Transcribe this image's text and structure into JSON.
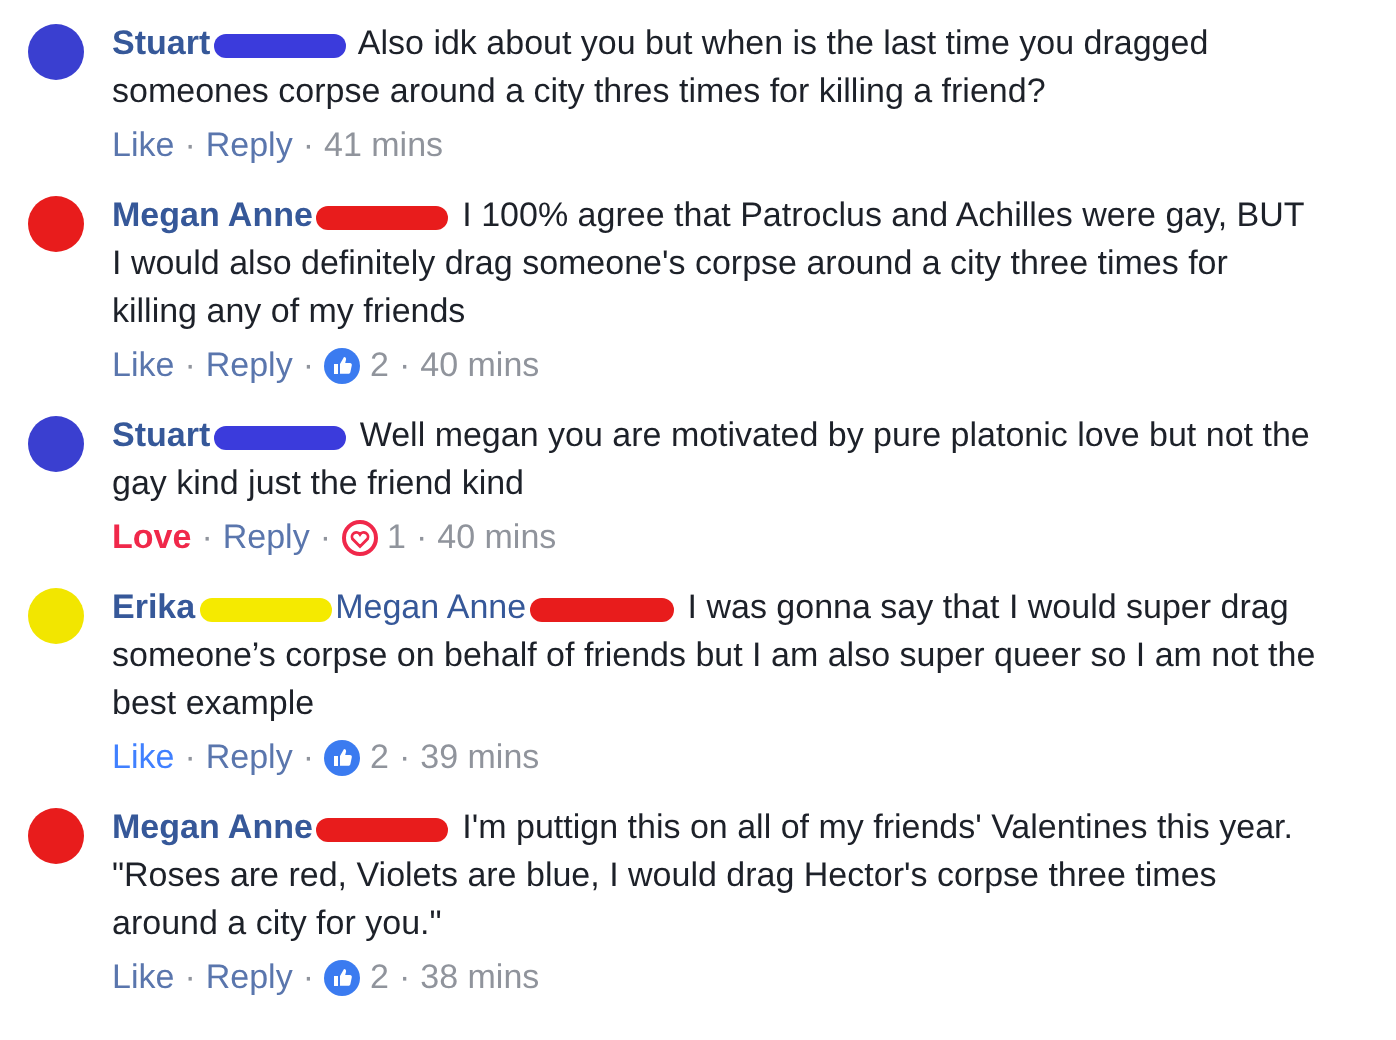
{
  "comments": [
    {
      "avatar": {
        "color": "#3a3fd0"
      },
      "author": "Stuart",
      "author_redaction": {
        "color": "#3b3bdc"
      },
      "text": "Also idk about you but when is the last time you dragged someones corpse around a city thres times for killing a friend?",
      "reaction": {
        "label": "Like",
        "kind": "none"
      },
      "reply": "Reply",
      "separators": [
        "·",
        "·"
      ],
      "time": "41 mins"
    },
    {
      "avatar": {
        "color": "#e81c1c"
      },
      "author": "Megan Anne",
      "author_redaction": {
        "color": "#e81c1c"
      },
      "text": "I 100% agree that Patroclus and Achilles were gay, BUT I would also definitely drag someone's corpse around a city three times for killing any of my friends",
      "reaction": {
        "label": "Like",
        "kind": "none"
      },
      "reply": "Reply",
      "separators": [
        "·",
        "·",
        "·"
      ],
      "count": {
        "kind": "like",
        "value": "2"
      },
      "time": "40 mins"
    },
    {
      "avatar": {
        "color": "#3a3fd0"
      },
      "author": "Stuart",
      "author_redaction": {
        "color": "#3b3bdc"
      },
      "text": "Well megan you are motivated by pure platonic love but not the gay kind just the friend kind",
      "reaction": {
        "label": "Love",
        "kind": "love"
      },
      "reply": "Reply",
      "separators": [
        "·",
        "·",
        "·"
      ],
      "count": {
        "kind": "love",
        "value": "1"
      },
      "time": "40 mins"
    },
    {
      "avatar": {
        "color": "#f2e600"
      },
      "author": "Erika",
      "author_redaction": {
        "color": "#f5ea00"
      },
      "mention": {
        "name": "Megan Anne",
        "redaction": {
          "color": "#e81c1c"
        }
      },
      "text": "I was gonna say that I would super drag someone’s corpse on behalf of friends but I am also super queer so I am not the best example",
      "reaction": {
        "label": "Like",
        "kind": "like"
      },
      "reply": "Reply",
      "separators": [
        "·",
        "·",
        "·"
      ],
      "count": {
        "kind": "like",
        "value": "2"
      },
      "time": "39 mins"
    },
    {
      "avatar": {
        "color": "#e81c1c"
      },
      "author": "Megan Anne",
      "author_redaction": {
        "color": "#e81c1c"
      },
      "text": "I'm puttign this on all of my friends' Valentines this year. \"Roses are red, Violets are blue, I would drag Hector's corpse three times around a city for you.\"",
      "reaction": {
        "label": "Like",
        "kind": "none"
      },
      "reply": "Reply",
      "separators": [
        "·",
        "·",
        "·"
      ],
      "count": {
        "kind": "like",
        "value": "2"
      },
      "time": "38 mins"
    }
  ]
}
